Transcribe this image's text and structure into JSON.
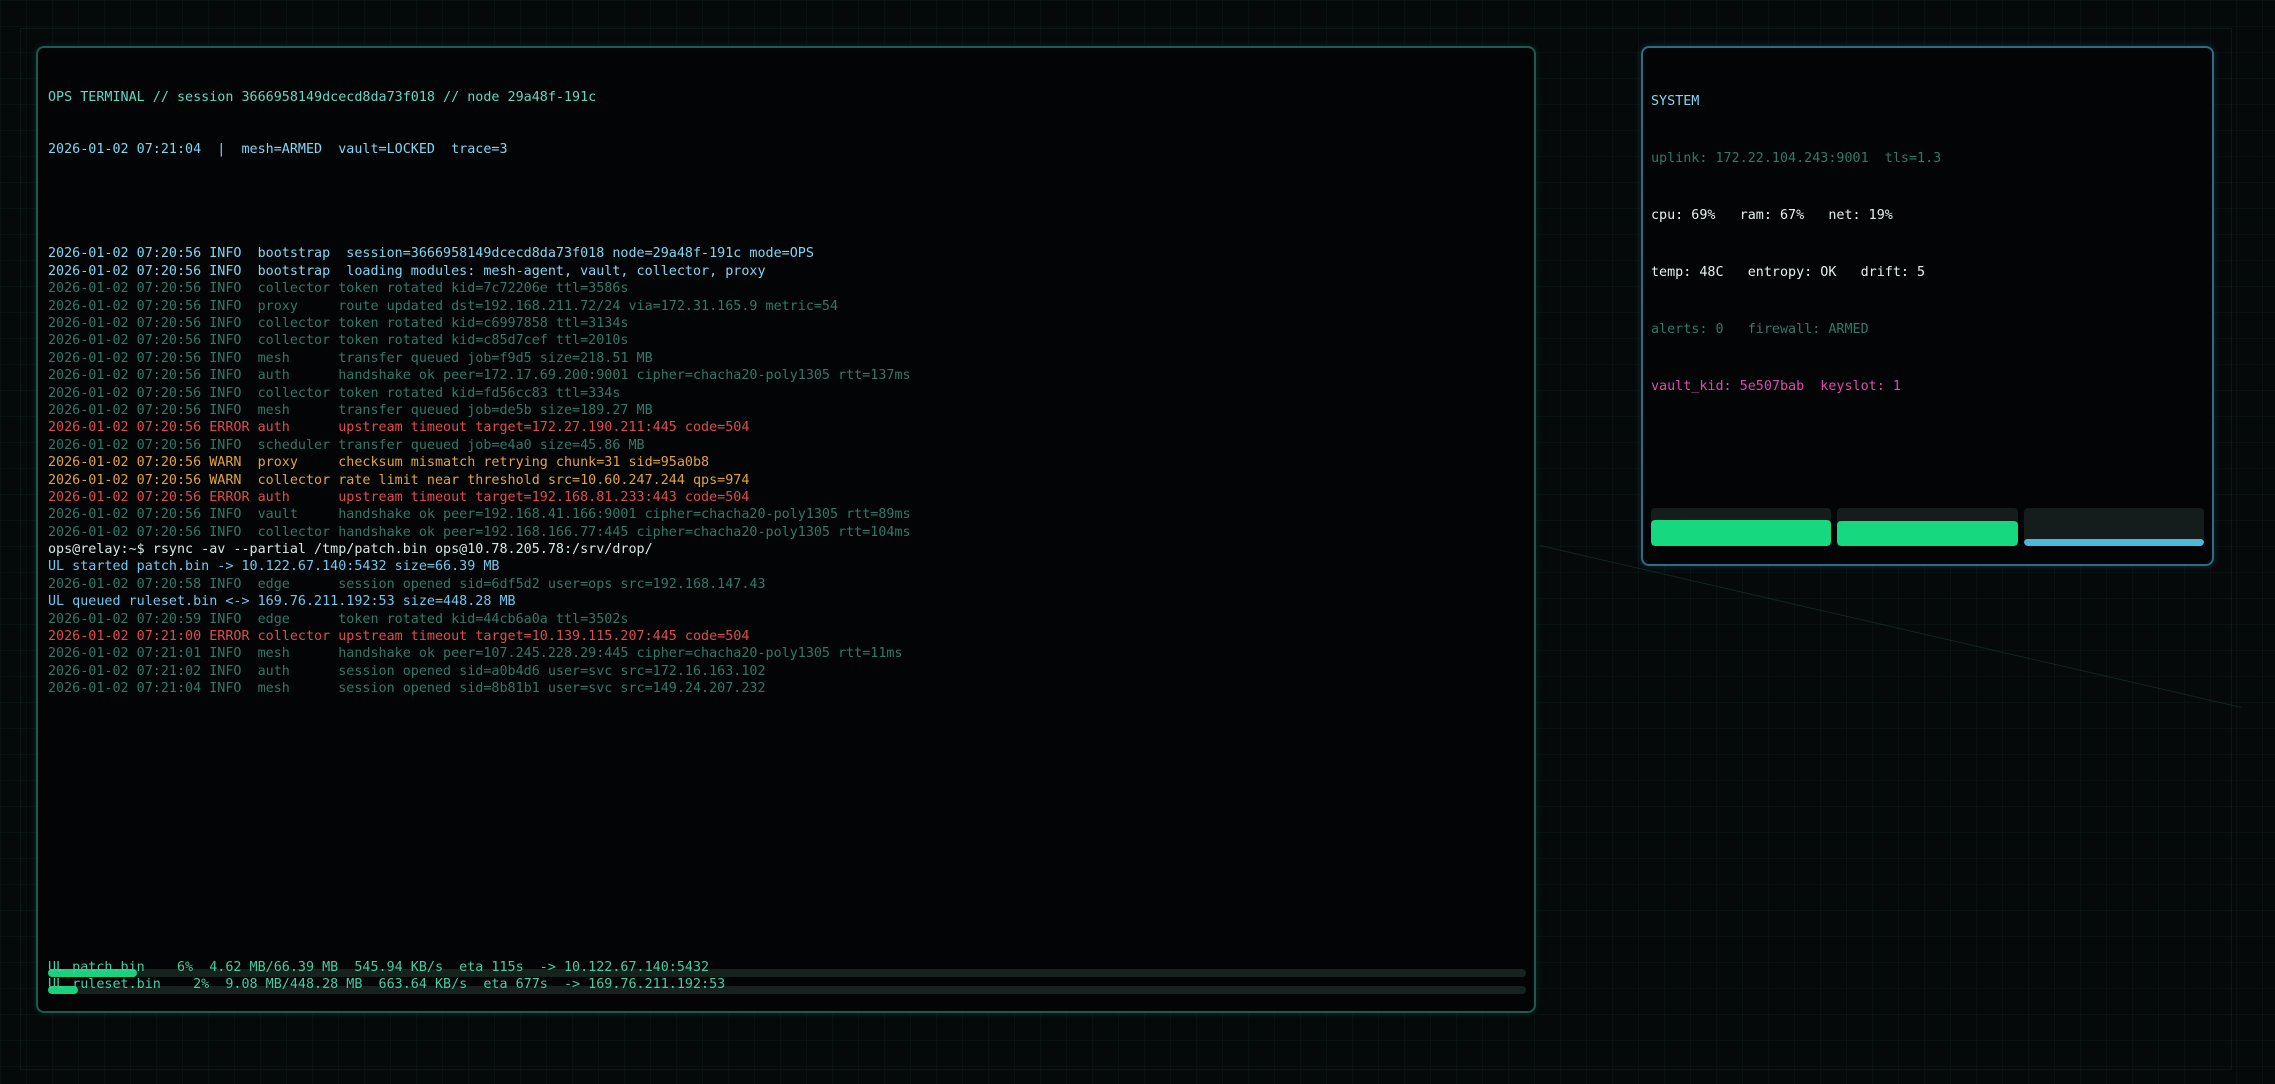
{
  "terminal": {
    "header": "OPS TERMINAL // session 3666958149dcecd8da73f018 // node 29a48f-191c",
    "status": "2026-01-02 07:21:04  |  mesh=ARMED  vault=LOCKED  trace=3",
    "lines": [
      {
        "level": "boot",
        "text": "2026-01-02 07:20:56 INFO  bootstrap  session=3666958149dcecd8da73f018 node=29a48f-191c mode=OPS"
      },
      {
        "level": "boot",
        "text": "2026-01-02 07:20:56 INFO  bootstrap  loading modules: mesh-agent, vault, collector, proxy"
      },
      {
        "level": "info",
        "text": "2026-01-02 07:20:56 INFO  collector token rotated kid=7c72206e ttl=3586s"
      },
      {
        "level": "info",
        "text": "2026-01-02 07:20:56 INFO  proxy     route updated dst=192.168.211.72/24 via=172.31.165.9 metric=54"
      },
      {
        "level": "info",
        "text": "2026-01-02 07:20:56 INFO  collector token rotated kid=c6997858 ttl=3134s"
      },
      {
        "level": "info",
        "text": "2026-01-02 07:20:56 INFO  collector token rotated kid=c85d7cef ttl=2010s"
      },
      {
        "level": "info",
        "text": "2026-01-02 07:20:56 INFO  mesh      transfer queued job=f9d5 size=218.51 MB"
      },
      {
        "level": "info",
        "text": "2026-01-02 07:20:56 INFO  auth      handshake ok peer=172.17.69.200:9001 cipher=chacha20-poly1305 rtt=137ms"
      },
      {
        "level": "info",
        "text": "2026-01-02 07:20:56 INFO  collector token rotated kid=fd56cc83 ttl=334s"
      },
      {
        "level": "info",
        "text": "2026-01-02 07:20:56 INFO  mesh      transfer queued job=de5b size=189.27 MB"
      },
      {
        "level": "error",
        "text": "2026-01-02 07:20:56 ERROR auth      upstream timeout target=172.27.190.211:445 code=504"
      },
      {
        "level": "info",
        "text": "2026-01-02 07:20:56 INFO  scheduler transfer queued job=e4a0 size=45.86 MB"
      },
      {
        "level": "warn",
        "text": "2026-01-02 07:20:56 WARN  proxy     checksum mismatch retrying chunk=31 sid=95a0b8"
      },
      {
        "level": "warn",
        "text": "2026-01-02 07:20:56 WARN  collector rate limit near threshold src=10.60.247.244 qps=974"
      },
      {
        "level": "error",
        "text": "2026-01-02 07:20:56 ERROR auth      upstream timeout target=192.168.81.233:443 code=504"
      },
      {
        "level": "info",
        "text": "2026-01-02 07:20:56 INFO  vault     handshake ok peer=192.168.41.166:9001 cipher=chacha20-poly1305 rtt=89ms"
      },
      {
        "level": "info",
        "text": "2026-01-02 07:20:56 INFO  collector handshake ok peer=192.168.166.77:445 cipher=chacha20-poly1305 rtt=104ms"
      },
      {
        "level": "cmd",
        "text": "ops@relay:~$ rsync -av --partial /tmp/patch.bin ops@10.78.205.78:/srv/drop/"
      },
      {
        "level": "ul",
        "text": "UL started patch.bin -> 10.122.67.140:5432 size=66.39 MB"
      },
      {
        "level": "info",
        "text": "2026-01-02 07:20:58 INFO  edge      session opened sid=6df5d2 user=ops src=192.168.147.43"
      },
      {
        "level": "ul",
        "text": "UL queued ruleset.bin <-> 169.76.211.192:53 size=448.28 MB"
      },
      {
        "level": "info",
        "text": "2026-01-02 07:20:59 INFO  edge      token rotated kid=44cb6a0a ttl=3502s"
      },
      {
        "level": "error",
        "text": "2026-01-02 07:21:00 ERROR collector upstream timeout target=10.139.115.207:445 code=504"
      },
      {
        "level": "info",
        "text": "2026-01-02 07:21:01 INFO  mesh      handshake ok peer=107.245.228.29:445 cipher=chacha20-poly1305 rtt=11ms"
      },
      {
        "level": "info",
        "text": "2026-01-02 07:21:02 INFO  auth      session opened sid=a0b4d6 user=svc src=172.16.163.102"
      },
      {
        "level": "info",
        "text": "2026-01-02 07:21:04 INFO  mesh      session opened sid=8b81b1 user=svc src=149.24.207.232"
      }
    ],
    "transfers": [
      {
        "text": "UL patch.bin    6%  4.62 MB/66.39 MB  545.94 KB/s  eta 115s  -> 10.122.67.140:5432",
        "progress": 0.06
      },
      {
        "text": "UL ruleset.bin    2%  9.08 MB/448.28 MB  663.64 KB/s  eta 677s  -> 169.76.211.192:53",
        "progress": 0.02
      }
    ]
  },
  "system": {
    "title": "SYSTEM",
    "uplink": "uplink: 172.22.104.243:9001  tls=1.3",
    "resources": "cpu: 69%   ram: 67%   net: 19%",
    "env": "temp: 48C   entropy: OK   drift: 5",
    "alerts": "alerts: 0   firewall: ARMED",
    "vault": "vault_kid: 5e507bab  keyslot: 1",
    "gauges": [
      {
        "name": "cpu",
        "level": 0.69,
        "color": "#16d97f"
      },
      {
        "name": "ram",
        "level": 0.67,
        "color": "#16d97f"
      },
      {
        "name": "net",
        "level": 0.19,
        "color": "#4ab8d8"
      }
    ]
  }
}
